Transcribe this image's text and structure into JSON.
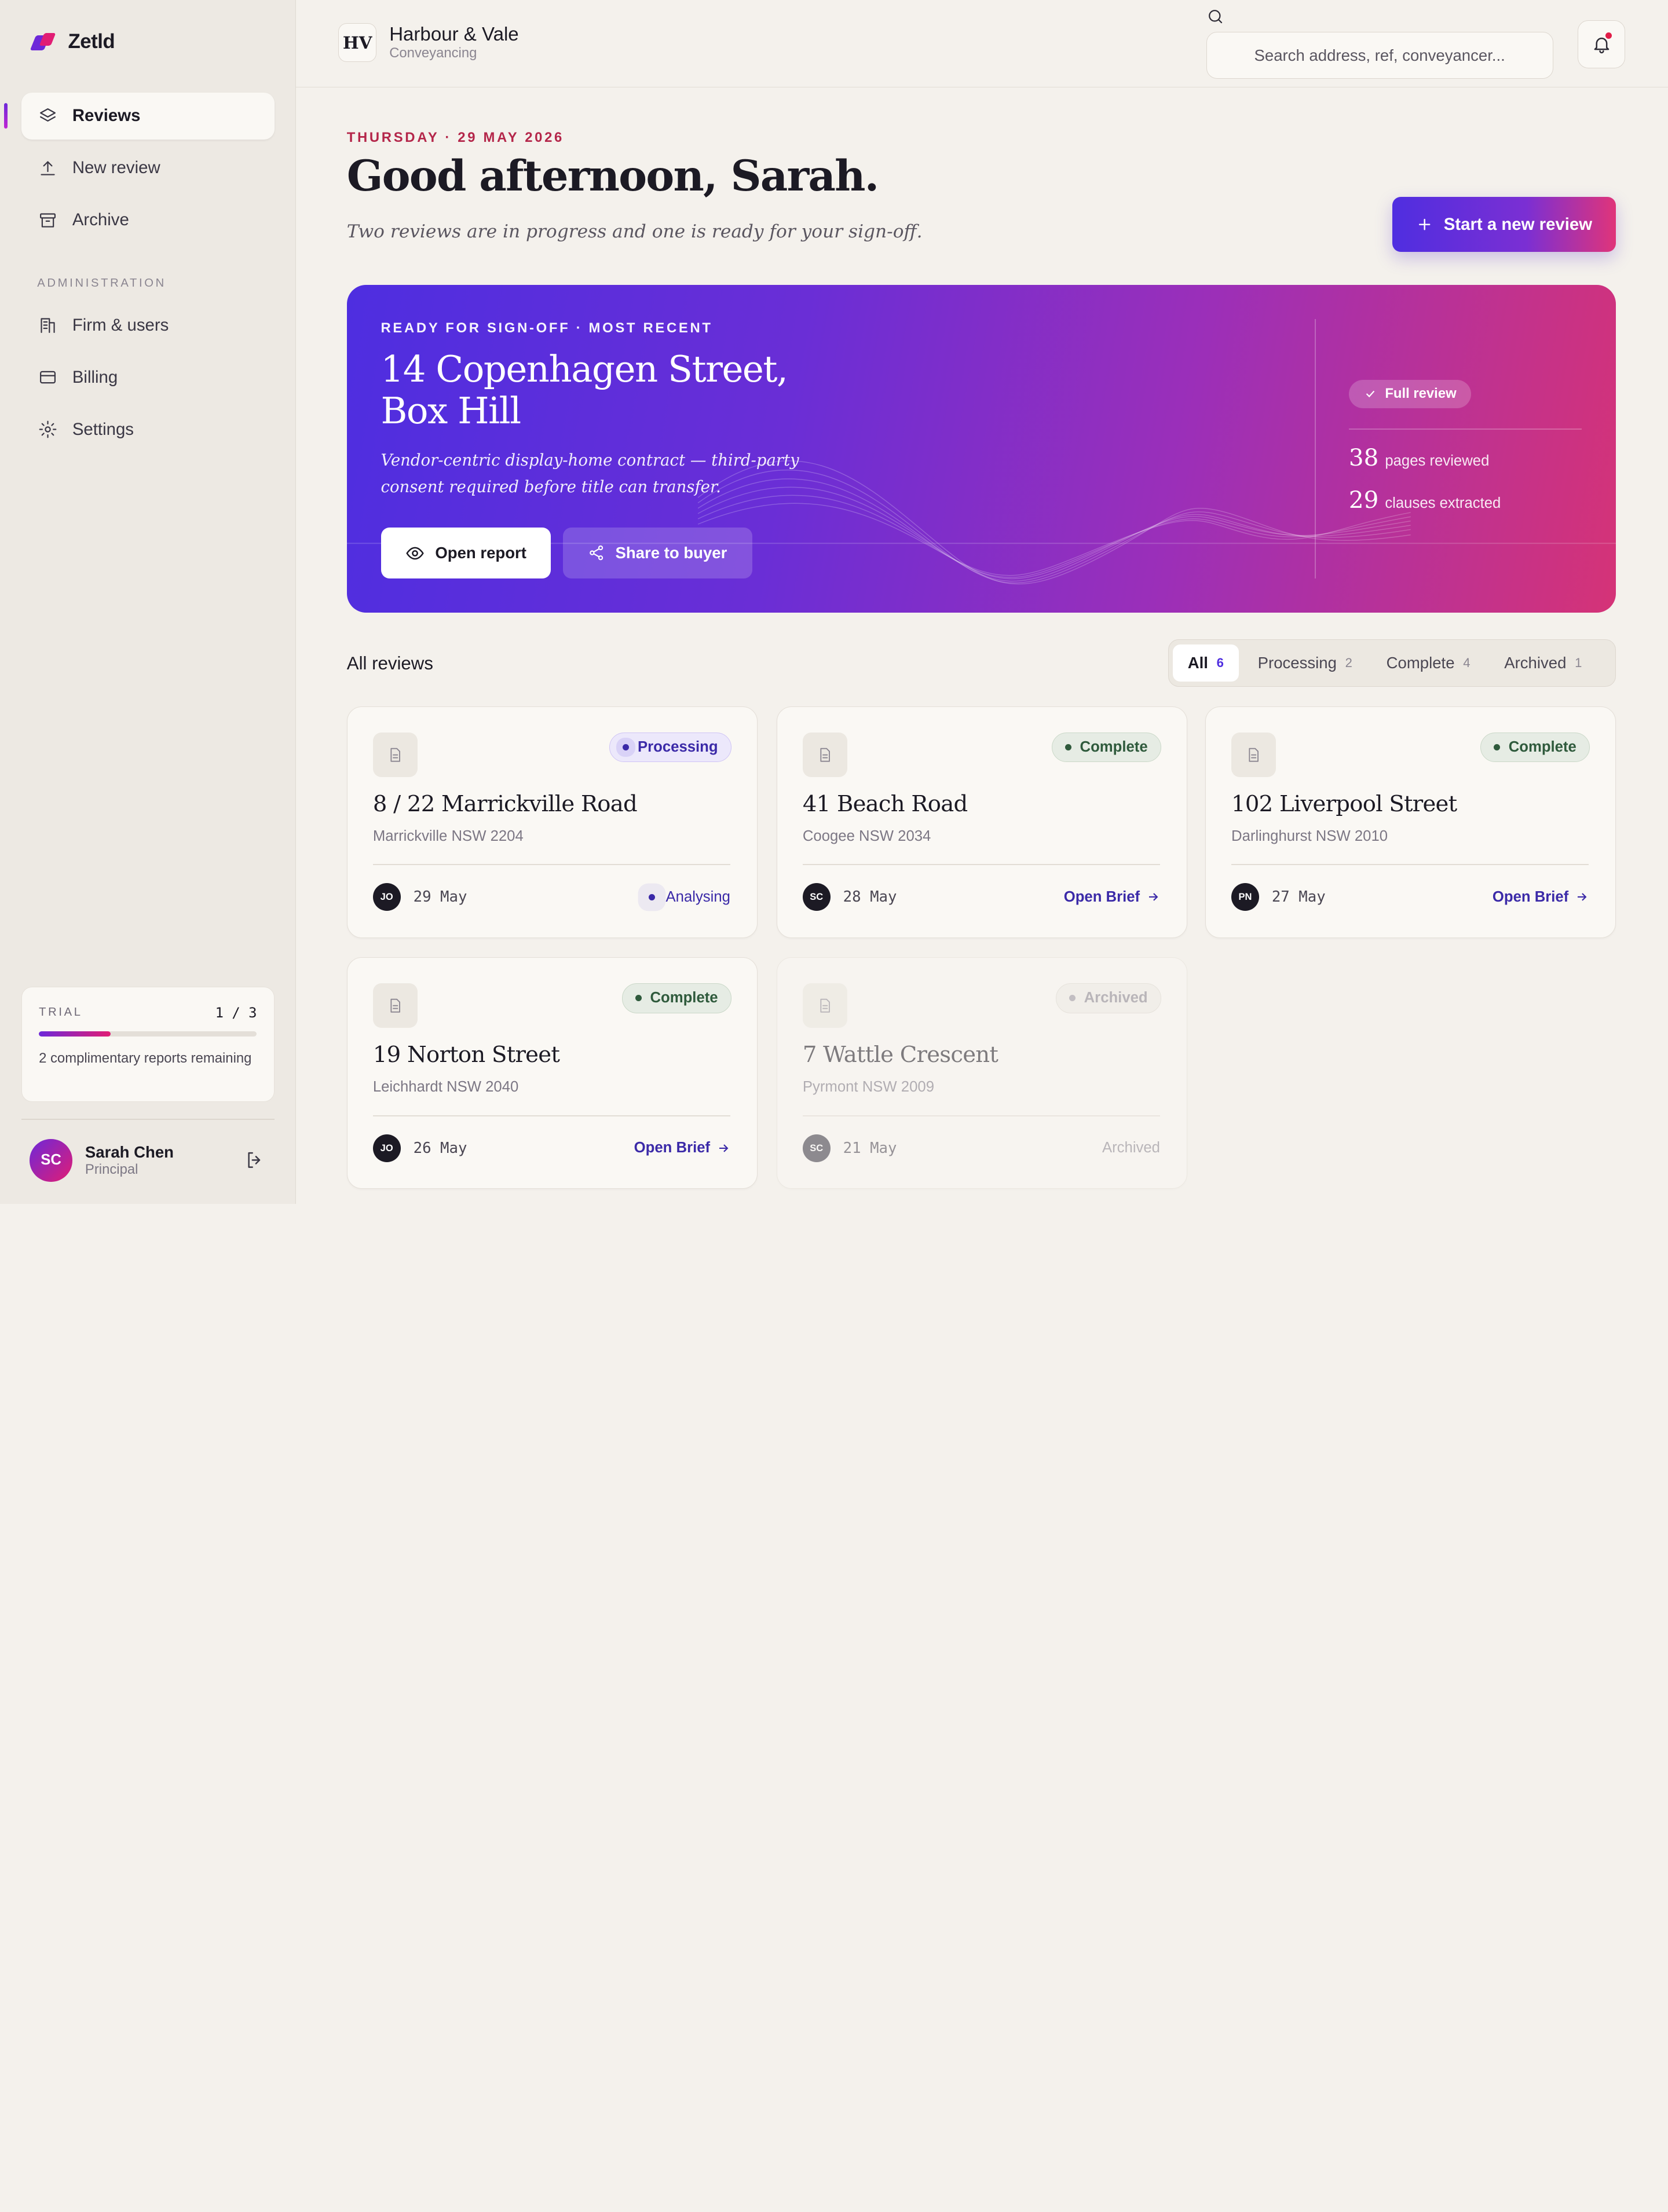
{
  "brand": {
    "name": "Zetld"
  },
  "sidebar": {
    "items": [
      {
        "label": "Reviews",
        "icon": "layers-icon"
      },
      {
        "label": "New review",
        "icon": "upload-icon"
      },
      {
        "label": "Archive",
        "icon": "archive-icon"
      }
    ],
    "section_label": "ADMINISTRATION",
    "admin_items": [
      {
        "label": "Firm & users",
        "icon": "building-icon"
      },
      {
        "label": "Billing",
        "icon": "card-icon"
      },
      {
        "label": "Settings",
        "icon": "gear-icon"
      }
    ],
    "trial": {
      "label": "TRIAL",
      "count": "1 / 3",
      "progress": 0.33,
      "note": "2 complimentary reports remaining"
    },
    "user": {
      "initials": "SC",
      "name": "Sarah Chen",
      "role": "Principal"
    }
  },
  "topbar": {
    "firm_initials": "HV",
    "firm_name": "Harbour & Vale",
    "firm_sub": "Conveyancing",
    "search_placeholder": "Search address, ref, conveyancer..."
  },
  "header": {
    "date": "THURSDAY · 29 MAY 2026",
    "greeting": "Good afternoon, Sarah.",
    "subtitle": "Two reviews are in progress and one is ready for your sign-off.",
    "new_button": "Start a new review"
  },
  "hero": {
    "eyebrow": "READY FOR SIGN-OFF · MOST RECENT",
    "title_line1": "14 Copenhagen Street,",
    "title_line2": "Box Hill",
    "description": "Vendor-centric display-home contract — third-party consent required before title can transfer.",
    "open_label": "Open report",
    "share_label": "Share to buyer",
    "pill": "Full review",
    "stat1_num": "38",
    "stat1_label": "pages reviewed",
    "stat2_num": "29",
    "stat2_label": "clauses extracted"
  },
  "reviews": {
    "title": "All reviews",
    "filters": [
      {
        "label": "All",
        "count": "6"
      },
      {
        "label": "Processing",
        "count": "2"
      },
      {
        "label": "Complete",
        "count": "4"
      },
      {
        "label": "Archived",
        "count": "1"
      }
    ],
    "cards": [
      {
        "title": "8 / 22 Marrickville Road",
        "sub": "Marrickville NSW 2204",
        "status": "Processing",
        "initials": "JO",
        "date": "29 May",
        "action": "Analysing"
      },
      {
        "title": "41 Beach Road",
        "sub": "Coogee NSW 2034",
        "status": "Complete",
        "initials": "SC",
        "date": "28 May",
        "action": "Open Brief"
      },
      {
        "title": "102 Liverpool Street",
        "sub": "Darlinghurst NSW 2010",
        "status": "Complete",
        "initials": "PN",
        "date": "27 May",
        "action": "Open Brief"
      },
      {
        "title": "19 Norton Street",
        "sub": "Leichhardt NSW 2040",
        "status": "Complete",
        "initials": "JO",
        "date": "26 May",
        "action": "Open Brief"
      },
      {
        "title": "7 Wattle Crescent",
        "sub": "Pyrmont NSW 2009",
        "status": "Archived",
        "initials": "SC",
        "date": "21 May",
        "action": "Archived"
      }
    ]
  },
  "colors": {
    "accent": "#4f2ee0",
    "brand_pink": "#e11d74",
    "complete": "#2f5a3c"
  }
}
